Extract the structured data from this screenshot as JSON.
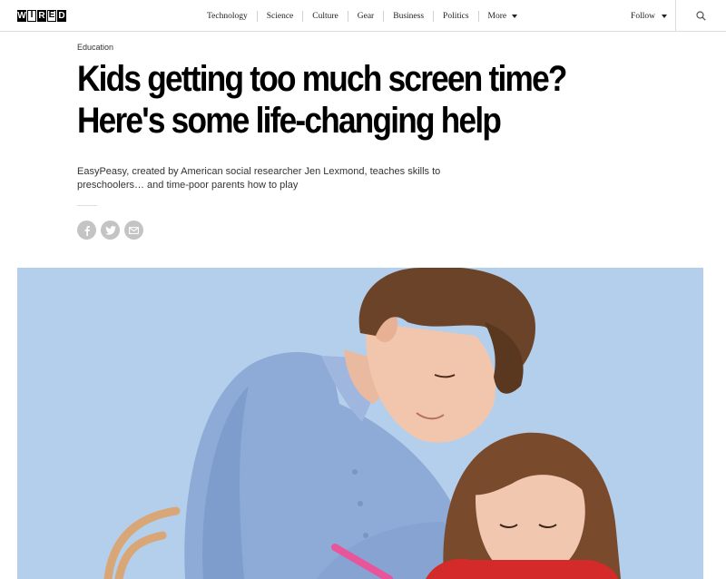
{
  "brand": {
    "logo_letters": [
      "W",
      "I",
      "R",
      "E",
      "D"
    ]
  },
  "nav": {
    "items": [
      "Technology",
      "Science",
      "Culture",
      "Gear",
      "Business",
      "Politics"
    ],
    "more_label": "More",
    "follow_label": "Follow"
  },
  "article": {
    "category": "Education",
    "headline_lines": [
      "Kids getting too much screen time?",
      "Here's some life-changing help"
    ],
    "dek": "EasyPeasy, created by American social researcher Jen Lexmond, teaches skills to preschoolers… and time-poor parents how to play"
  },
  "share": {
    "icons": [
      "facebook-icon",
      "twitter-icon",
      "email-icon"
    ]
  },
  "colors": {
    "hero_background": "#b4cfec",
    "share_circle": "#c4c4c4",
    "shirt": "#8eaad6",
    "child_top": "#d42a2a",
    "pencil": "#e8559a"
  }
}
